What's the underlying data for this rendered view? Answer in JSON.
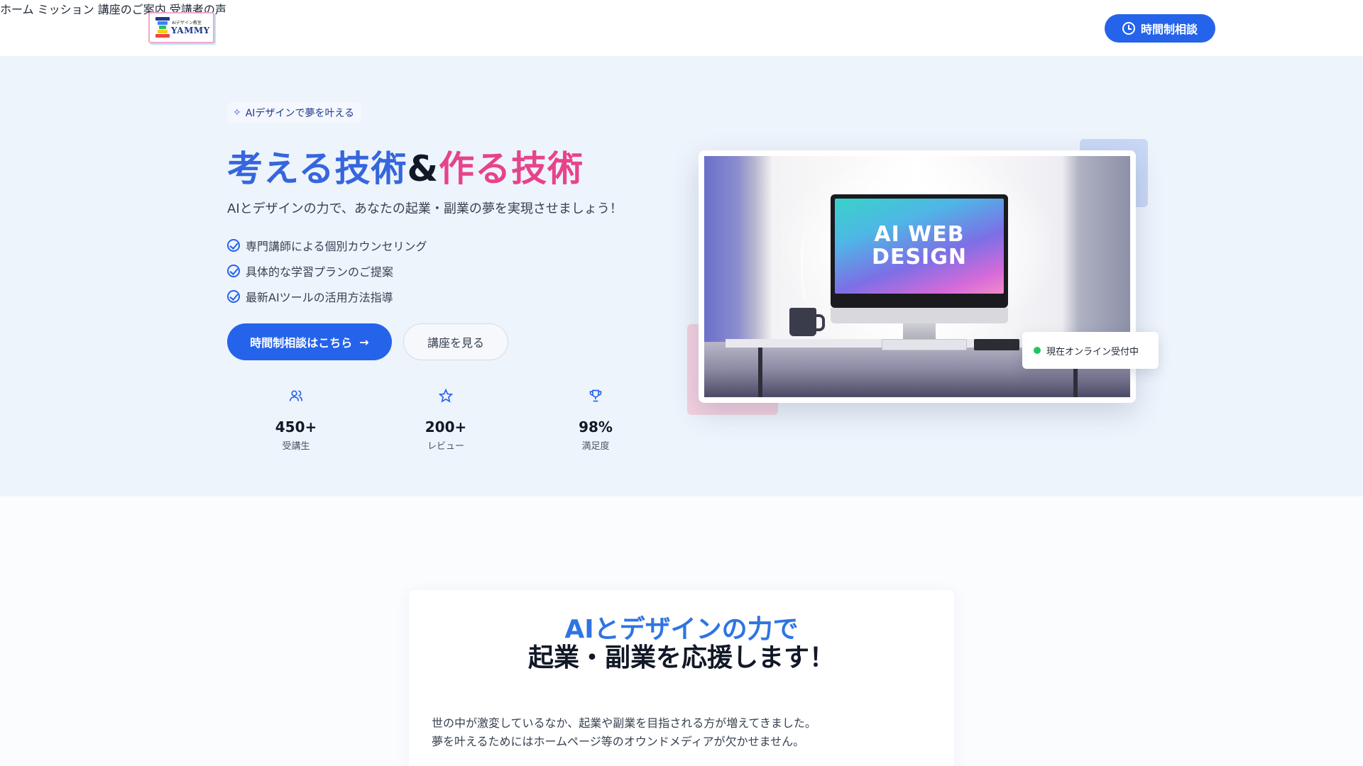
{
  "header": {
    "logo": {
      "small_text": "AIデザイン教室",
      "name": "YAMMY"
    },
    "nav": [
      {
        "label": "ホーム"
      },
      {
        "label": "ミッション"
      },
      {
        "label": "講座のご案内"
      },
      {
        "label": "受講者の声"
      }
    ],
    "cta_label": "時間制相談"
  },
  "hero": {
    "badge": "AIデザインで夢を叶える",
    "title_part1": "考える技術",
    "title_amp": "&",
    "title_part2": "作る技術",
    "subtitle": "AIとデザインの力で、あなたの起業・副業の夢を実現させましょう！",
    "features": [
      "専門講師による個別カウンセリング",
      "具体的な学習プランのご提案",
      "最新AIツールの活用方法指導"
    ],
    "primary_button": "時間制相談はこちら",
    "secondary_button": "講座を見る",
    "stats": [
      {
        "icon": "users-icon",
        "value": "450+",
        "label": "受講生"
      },
      {
        "icon": "star-icon",
        "value": "200+",
        "label": "レビュー"
      },
      {
        "icon": "trophy-icon",
        "value": "98%",
        "label": "満足度"
      }
    ],
    "image": {
      "screen_line1": "AI WEB",
      "screen_line2": "DESIGN"
    },
    "online_status": "現在オンライン受付中"
  },
  "mission": {
    "title_line1": "AIとデザインの力で",
    "title_line2": "起業・副業を応援します！",
    "paragraph_line1": "世の中が激変しているなか、起業や副業を目指される方が増えてきました。",
    "paragraph_line2": "夢を叶えるためにはホームページ等のオウンドメディアが欠かせません。"
  },
  "colors": {
    "primary": "#2563eb",
    "title_blue": "#3566dd",
    "title_pink": "#e7438b",
    "online_green": "#22c55e",
    "hero_bg": "#eef4fc"
  }
}
